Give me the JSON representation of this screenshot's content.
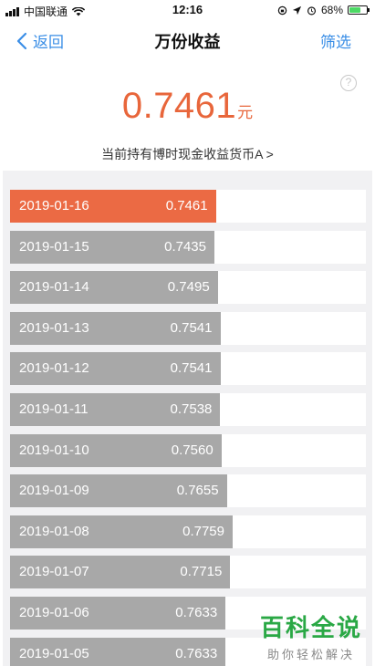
{
  "status": {
    "carrier": "中国联通",
    "time": "12:16",
    "battery": "68%",
    "battery_level": 0.68
  },
  "nav": {
    "back_label": "返回",
    "title": "万份收益",
    "filter_label": "筛选"
  },
  "header": {
    "help_label": "?",
    "yield_value": "0.7461",
    "yield_unit": "元",
    "fund_link": "当前持有博时现金收益货币A >"
  },
  "colors": {
    "accent": "#eb6a44",
    "link": "#3a8ee6",
    "bar": "#a8a8a8",
    "watermark": "#2aa845"
  },
  "rows": [
    {
      "date": "2019-01-16",
      "value": "0.7461",
      "active": true
    },
    {
      "date": "2019-01-15",
      "value": "0.7435",
      "active": false
    },
    {
      "date": "2019-01-14",
      "value": "0.7495",
      "active": false
    },
    {
      "date": "2019-01-13",
      "value": "0.7541",
      "active": false
    },
    {
      "date": "2019-01-12",
      "value": "0.7541",
      "active": false
    },
    {
      "date": "2019-01-11",
      "value": "0.7538",
      "active": false
    },
    {
      "date": "2019-01-10",
      "value": "0.7560",
      "active": false
    },
    {
      "date": "2019-01-09",
      "value": "0.7655",
      "active": false
    },
    {
      "date": "2019-01-08",
      "value": "0.7759",
      "active": false
    },
    {
      "date": "2019-01-07",
      "value": "0.7715",
      "active": false
    },
    {
      "date": "2019-01-06",
      "value": "0.7633",
      "active": false
    },
    {
      "date": "2019-01-05",
      "value": "0.7633",
      "active": false
    }
  ],
  "watermark": {
    "main": "百科全说",
    "sub": "助你轻松解决"
  }
}
